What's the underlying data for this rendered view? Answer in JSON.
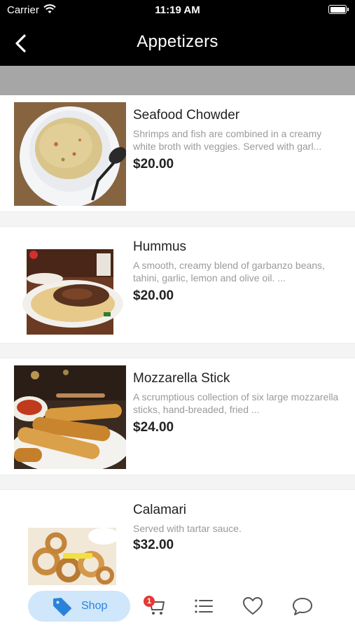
{
  "status_bar": {
    "carrier": "Carrier",
    "time": "11:19 AM"
  },
  "nav": {
    "title": "Appetizers"
  },
  "items": [
    {
      "name": "Seafood Chowder",
      "description": "Shrimps and fish are combined in a creamy white broth with veggies. Served with garl...",
      "price": "$20.00",
      "image": "seafood-chowder-photo"
    },
    {
      "name": "Hummus",
      "description": "A smooth, creamy blend of garbanzo beans, tahini, garlic, lemon and olive oil. ...",
      "price": "$20.00",
      "image": "hummus-photo"
    },
    {
      "name": "Mozzarella Stick",
      "description": "A scrumptious collection of six large mozzarella sticks, hand-breaded, fried ...",
      "price": "$24.00",
      "image": "mozzarella-sticks-photo"
    },
    {
      "name": "Calamari",
      "description": "Served with tartar sauce.",
      "price": "$32.00",
      "image": "calamari-photo"
    }
  ],
  "tab_bar": {
    "shop_label": "Shop",
    "cart_badge": "1",
    "icons": [
      "tag-icon",
      "cart-icon",
      "list-icon",
      "heart-icon",
      "chat-icon"
    ]
  },
  "colors": {
    "header": "#000000",
    "band": "#a6a6a6",
    "accent": "#2a83d9",
    "shop_pill": "#cfe6fb",
    "badge": "#e53935"
  }
}
